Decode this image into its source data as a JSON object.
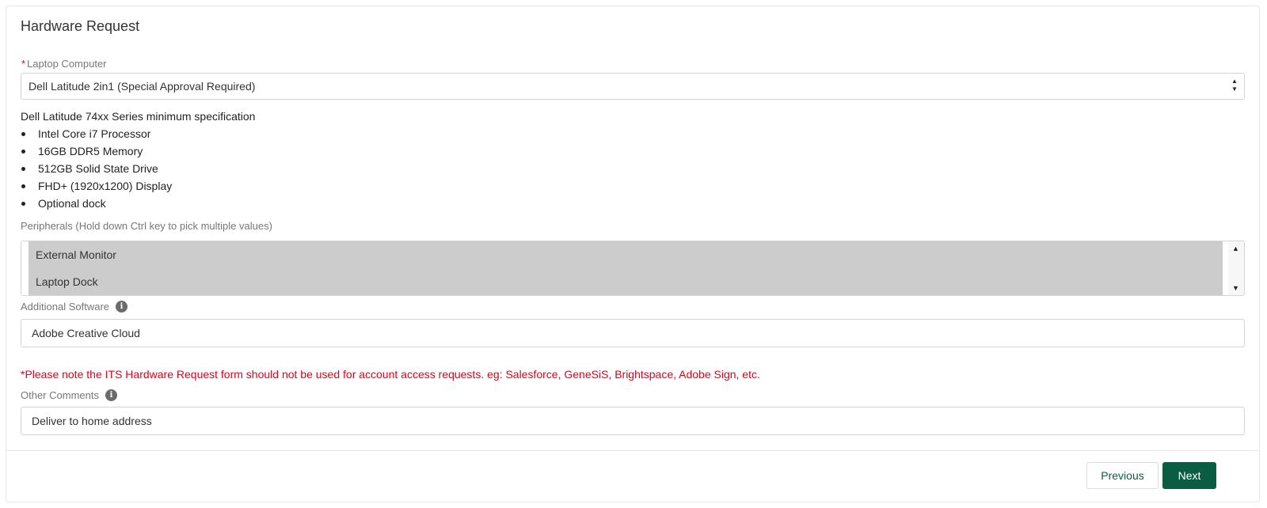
{
  "form": {
    "title": "Hardware Request"
  },
  "laptop": {
    "required_marker": "*",
    "label": "Laptop Computer",
    "selected_value": "Dell Latitude 2in1 (Special Approval Required)"
  },
  "spec": {
    "heading": "Dell Latitude 74xx Series minimum specification",
    "items": [
      "Intel Core i7 Processor",
      "16GB DDR5 Memory",
      "512GB Solid State Drive",
      "FHD+ (1920x1200) Display",
      "Optional dock"
    ]
  },
  "peripherals": {
    "label": "Peripherals (Hold down Ctrl key to pick multiple values)",
    "options": [
      "External Monitor",
      "Laptop Dock"
    ]
  },
  "software": {
    "label": "Additional Software",
    "value": "Adobe Creative Cloud"
  },
  "notice": "*Please note the ITS Hardware Request form should not be used for account access requests. eg: Salesforce, GeneSiS, Brightspace, Adobe Sign, etc.",
  "comments": {
    "label": "Other Comments",
    "value": "Deliver to home address"
  },
  "footer": {
    "previous_label": "Previous",
    "next_label": "Next"
  },
  "colors": {
    "accent": "#0a5c43",
    "notice_red": "#e0001b",
    "selected_option_bg": "#cccccc"
  },
  "icons": {
    "info": "info-icon",
    "spinner_up": "triangle-up",
    "spinner_down": "triangle-down"
  }
}
